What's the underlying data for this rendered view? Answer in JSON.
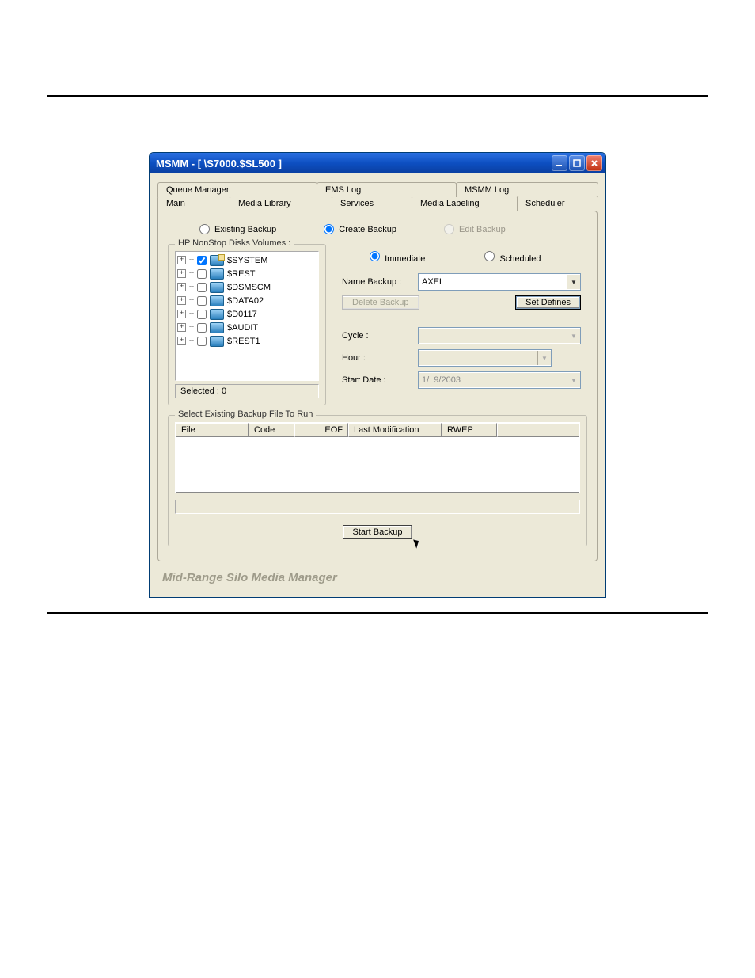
{
  "window": {
    "title": "MSMM - [ \\S7000.$SL500 ]"
  },
  "tabs_back": [
    "Queue Manager",
    "EMS Log",
    "MSMM Log"
  ],
  "tabs_front": [
    "Main",
    "Media Library",
    "Services",
    "Media Labeling",
    "Scheduler"
  ],
  "mode_radios": {
    "existing": "Existing Backup",
    "create": "Create Backup",
    "edit": "Edit Backup"
  },
  "disks": {
    "legend": "HP NonStop Disks Volumes :",
    "items": [
      "$SYSTEM",
      "$REST",
      "$DSMSCM",
      "$DATA02",
      "$D0117",
      "$AUDIT",
      "$REST1"
    ],
    "selected_label": "Selected : 0"
  },
  "run_radios": {
    "immediate": "Immediate",
    "scheduled": "Scheduled"
  },
  "name_backup": {
    "label": "Name Backup :",
    "value": "AXEL"
  },
  "buttons": {
    "delete_backup": "Delete Backup",
    "set_defines": "Set Defines",
    "start_backup": "Start Backup"
  },
  "schedule": {
    "cycle_label": "Cycle :",
    "cycle_value": "",
    "hour_label": "Hour :",
    "hour_value": "",
    "startdate_label": "Start Date :",
    "startdate_value": "1/  9/2003"
  },
  "filelist": {
    "legend": "Select Existing Backup File To Run",
    "columns": [
      "File",
      "Code",
      "EOF",
      "Last Modification",
      "RWEP"
    ]
  },
  "footer": "Mid-Range Silo Media Manager"
}
